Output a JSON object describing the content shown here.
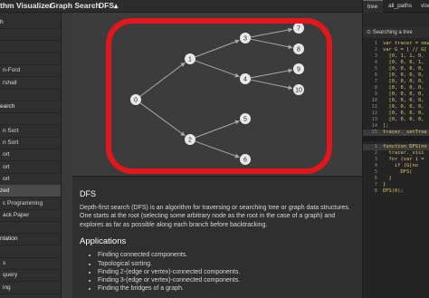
{
  "breadcrumb": {
    "app": "thm Visualizer",
    "section": "Graph Search",
    "page": "DFS",
    "caret": "▴"
  },
  "sidebar": {
    "items": [
      {
        "label": "h",
        "kind": "sec"
      },
      {
        "label": "",
        "kind": "ind"
      },
      {
        "label": "",
        "kind": "ind"
      },
      {
        "label": "",
        "kind": "ind"
      },
      {
        "label": "n-Ford",
        "kind": "ind"
      },
      {
        "label": "rshall",
        "kind": "ind"
      },
      {
        "label": "",
        "kind": "ind"
      },
      {
        "label": "earch",
        "kind": "sec"
      },
      {
        "label": "",
        "kind": "ind"
      },
      {
        "label": "n Sort",
        "kind": "ind"
      },
      {
        "label": "n Sort",
        "kind": "ind"
      },
      {
        "label": "ort",
        "kind": "ind"
      },
      {
        "label": "ort",
        "kind": "ind"
      },
      {
        "label": "ort",
        "kind": "ind"
      },
      {
        "label": "zed",
        "kind": "sec",
        "selected": true
      },
      {
        "label": "c Programming",
        "kind": "ind"
      },
      {
        "label": "ack Paper",
        "kind": "ind"
      },
      {
        "label": "",
        "kind": "ind"
      },
      {
        "label": "ntation",
        "kind": "sec"
      },
      {
        "label": "",
        "kind": "ind"
      },
      {
        "label": "s",
        "kind": "ind"
      },
      {
        "label": "query",
        "kind": "ind"
      },
      {
        "label": "ing",
        "kind": "ind"
      }
    ]
  },
  "graph": {
    "nodes": [
      "0",
      "1",
      "2",
      "3",
      "4",
      "5",
      "6",
      "7",
      "8",
      "9",
      "10"
    ],
    "edges": [
      [
        "0",
        "1"
      ],
      [
        "0",
        "2"
      ],
      [
        "1",
        "3"
      ],
      [
        "1",
        "4"
      ],
      [
        "2",
        "5"
      ],
      [
        "2",
        "6"
      ],
      [
        "3",
        "7"
      ],
      [
        "3",
        "8"
      ],
      [
        "4",
        "9"
      ],
      [
        "4",
        "10"
      ]
    ]
  },
  "description": {
    "title": "DFS",
    "text": "Depth-first search (DFS) is an algorithm for traversing or searching tree or graph data structures. One starts at the root (selecting some arbitrary node as the root in the case of a graph) and explores as far as possible along each branch before backtracking.",
    "applications_title": "Applications",
    "applications": [
      "Finding connected components.",
      "Topological sorting.",
      "Finding 2-(edge or vertex)-connected components.",
      "Finding 3-(edge or vertex)-connected components.",
      "Finding the bridges of a graph."
    ]
  },
  "right_panel": {
    "tabs": [
      "tree",
      "all_paths",
      "visu"
    ],
    "log_text": "Searching a tree",
    "code_top": [
      {
        "n": "1",
        "t": "var tracer = new"
      },
      {
        "n": "2",
        "t": "var G = [ // G["
      },
      {
        "n": "3",
        "t": "  [0, 1, 1, 0,"
      },
      {
        "n": "4",
        "t": "  [0, 0, 0, 1,"
      },
      {
        "n": "5",
        "t": "  [0, 0, 0, 0,"
      },
      {
        "n": "6",
        "t": "  [0, 0, 0, 0,"
      },
      {
        "n": "7",
        "t": "  [0, 0, 0, 0,"
      },
      {
        "n": "8",
        "t": "  [0, 0, 0, 0,"
      },
      {
        "n": "9",
        "t": "  [0, 0, 0, 0,"
      },
      {
        "n": "10",
        "t": "  [0, 0, 0, 0,"
      },
      {
        "n": "11",
        "t": "  [0, 0, 0, 0,"
      },
      {
        "n": "12",
        "t": "  [0, 0, 0, 0,"
      },
      {
        "n": "13",
        "t": "  [0, 0, 0, 0,"
      },
      {
        "n": "14",
        "t": "];"
      },
      {
        "n": "15",
        "t": "tracer._setTree"
      }
    ],
    "code_bottom": [
      {
        "n": "1",
        "t": "function DFS(no"
      },
      {
        "n": "2",
        "t": "  tracer._visi"
      },
      {
        "n": "3",
        "t": "  for (var i ="
      },
      {
        "n": "4",
        "t": "    if (G[no"
      },
      {
        "n": "5",
        "t": "      DFS("
      },
      {
        "n": "6",
        "t": "  }"
      },
      {
        "n": "7",
        "t": "}"
      },
      {
        "n": "8",
        "t": "DFS(0);"
      }
    ]
  },
  "colors": {
    "highlight_ring": "#e3171b",
    "node_fill": "#e8e8e8",
    "edge": "#a9a9a9",
    "code_keyword": "#e0c46c"
  }
}
